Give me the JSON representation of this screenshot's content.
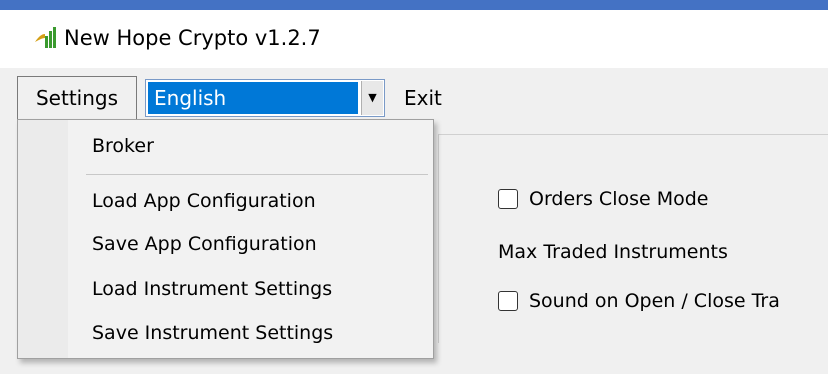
{
  "window": {
    "title": "New Hope Crypto v1.2.7",
    "icon": "app-chart-icon",
    "accent_color": "#4472c4"
  },
  "menubar": {
    "settings_label": "Settings",
    "language_selected": "English",
    "exit_label": "Exit"
  },
  "settings_menu": {
    "items": [
      "Broker",
      "Load App Configuration",
      "Save App Configuration",
      "Load Instrument Settings",
      "Save Instrument Settings"
    ]
  },
  "panel": {
    "orders_close_mode": {
      "label": "Orders Close Mode",
      "checked": false
    },
    "max_traded_label": "Max Traded Instruments",
    "sound_toggle": {
      "label": "Sound on Open / Close Tra",
      "checked": false
    }
  },
  "colors": {
    "selection": "#0078d7",
    "menu_background": "#f2f2f2",
    "client_background": "#f0f0f0"
  }
}
